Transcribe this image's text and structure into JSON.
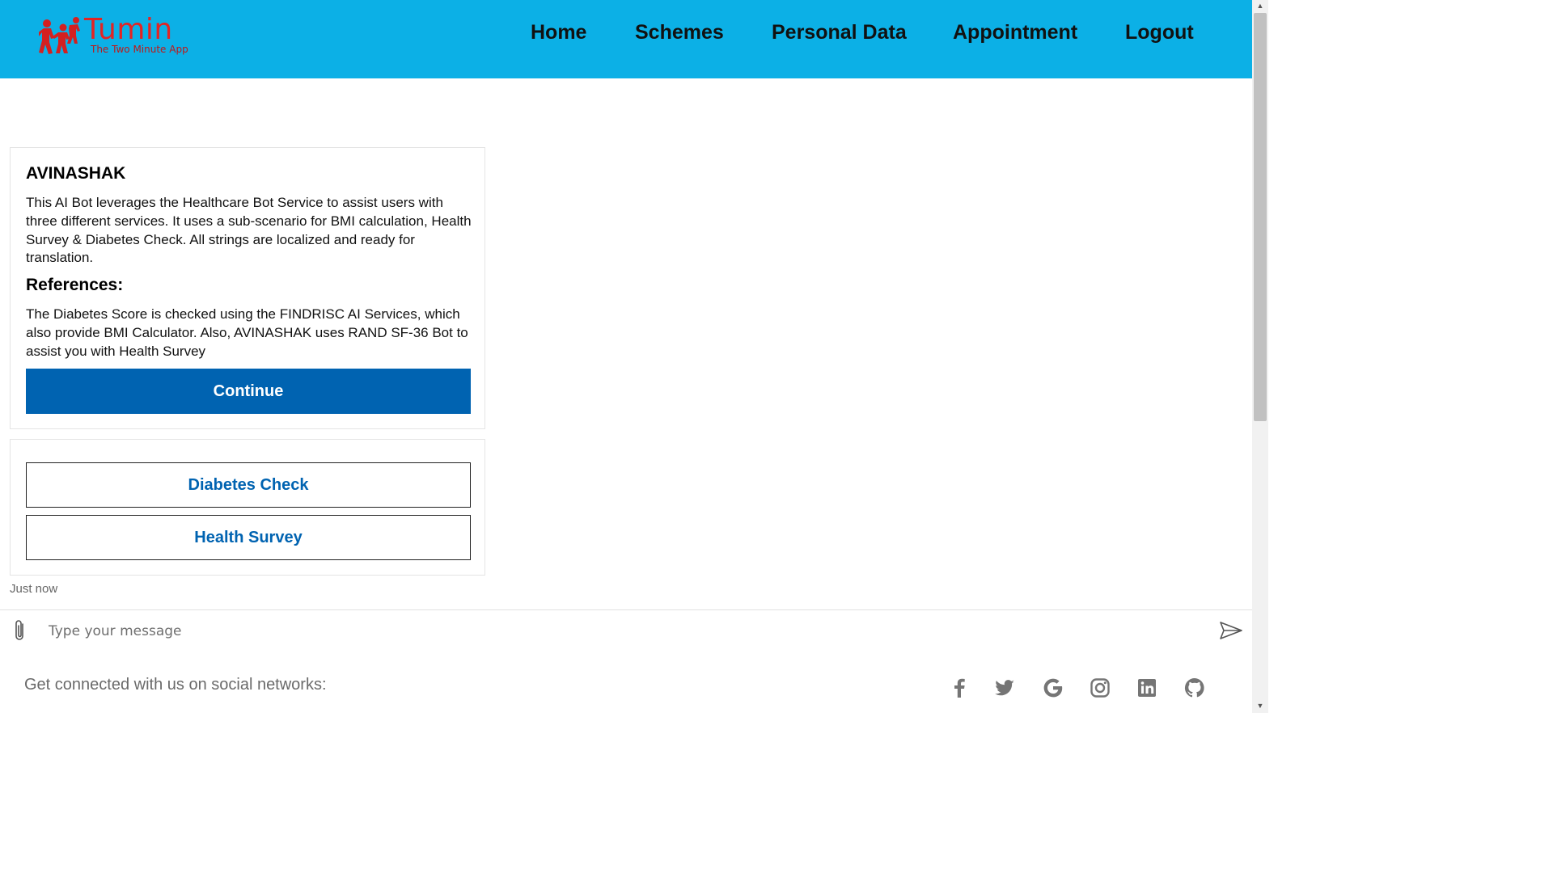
{
  "brand": {
    "name": "Tumin",
    "tagline": "The Two Minute App",
    "logo_icon": "children-figure-icon",
    "color": "#e32424"
  },
  "nav": {
    "background": "#0cb0e6",
    "items": [
      {
        "label": "Home"
      },
      {
        "label": "Schemes"
      },
      {
        "label": "Personal Data"
      },
      {
        "label": "Appointment"
      },
      {
        "label": "Logout"
      }
    ]
  },
  "hero_card": {
    "title": "AVINASHAK",
    "description": "This AI Bot leverages the Healthcare Bot Service to assist users with three different services. It uses a sub-scenario for BMI calculation, Health Survey & Diabetes Check. All strings are localized and ready for translation.",
    "subtitle": "References:",
    "references": "The Diabetes Score is checked using the FINDRISC AI Services, which also provide BMI Calculator. Also, AVINASHAK uses RAND SF-36 Bot to assist you with Health Survey",
    "continue_label": "Continue",
    "accent": "#0063b1"
  },
  "actions": [
    {
      "label": "Diabetes Check"
    },
    {
      "label": "Health Survey"
    }
  ],
  "timestamp": "Just now",
  "composer": {
    "placeholder": "Type your message",
    "attach_icon": "paperclip-icon",
    "send_icon": "send-icon"
  },
  "footer": {
    "text": "Get connected with us on social networks:",
    "icons": [
      "facebook-icon",
      "twitter-icon",
      "google-icon",
      "instagram-icon",
      "linkedin-icon",
      "github-icon"
    ]
  }
}
